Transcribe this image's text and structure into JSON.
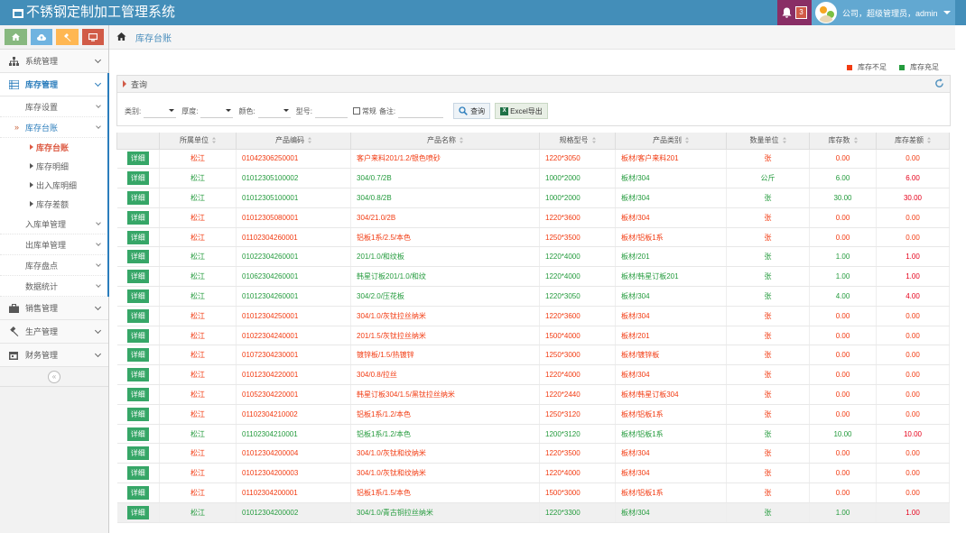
{
  "app": {
    "title": "不锈钢定制加工管理系统"
  },
  "header": {
    "notification_count": "3",
    "user_text": "公司，超级管理员，admin"
  },
  "sidebar": {
    "menu": [
      {
        "label": "系统管理"
      },
      {
        "label": "库存管理"
      },
      {
        "label": "销售管理"
      },
      {
        "label": "生产管理"
      },
      {
        "label": "财务管理"
      }
    ],
    "submenu": [
      {
        "label": "库存设置"
      },
      {
        "label": "库存台账"
      },
      {
        "label": "入库单管理"
      },
      {
        "label": "出库单管理"
      },
      {
        "label": "库存盘点"
      },
      {
        "label": "数据统计"
      }
    ],
    "subsub": [
      {
        "label": "库存台账"
      },
      {
        "label": "库存明细"
      },
      {
        "label": "出入库明细"
      },
      {
        "label": "库存差额"
      }
    ]
  },
  "breadcrumb": {
    "current": "库存台账"
  },
  "legend": {
    "low": "库存不足",
    "ok": "库存充足"
  },
  "colors": {
    "low": "#f23b12",
    "ok": "#249b3d",
    "brand": "#438eb9"
  },
  "query": {
    "title": "查询",
    "category_label": "类别:",
    "thickness_label": "厚度:",
    "color_label": "颜色:",
    "model_label": "型号:",
    "regular_label": "常规",
    "remark_label": "备注:",
    "search_btn": "查询",
    "excel_btn": "Excel导出"
  },
  "table": {
    "headers": [
      "",
      "所属单位",
      "产品编码",
      "产品名称",
      "规格型号",
      "产品类别",
      "数量单位",
      "库存数",
      "库存差额"
    ],
    "action_label": "详细",
    "rows": [
      {
        "status": "red",
        "unit": "松江",
        "code": "01042306250001",
        "name": "客户来料201/1.2/银色喷砂",
        "spec": "1220*3050",
        "cat": "板材/客户来料201",
        "qty_unit": "张",
        "stock": "0.00",
        "diff": "0.00"
      },
      {
        "status": "green",
        "unit": "松江",
        "code": "01012305100002",
        "name": "304/0.7/2B",
        "spec": "1000*2000",
        "cat": "板材/304",
        "qty_unit": "公斤",
        "stock": "6.00",
        "diff": "6.00"
      },
      {
        "status": "green",
        "unit": "松江",
        "code": "01012305100001",
        "name": "304/0.8/2B",
        "spec": "1000*2000",
        "cat": "板材/304",
        "qty_unit": "张",
        "stock": "30.00",
        "diff": "30.00"
      },
      {
        "status": "red",
        "unit": "松江",
        "code": "01012305080001",
        "name": "304/21.0/2B",
        "spec": "1220*3600",
        "cat": "板材/304",
        "qty_unit": "张",
        "stock": "0.00",
        "diff": "0.00"
      },
      {
        "status": "red",
        "unit": "松江",
        "code": "01102304260001",
        "name": "铝板1系/2.5/本色",
        "spec": "1250*3500",
        "cat": "板材/铝板1系",
        "qty_unit": "张",
        "stock": "0.00",
        "diff": "0.00"
      },
      {
        "status": "green",
        "unit": "松江",
        "code": "01022304260001",
        "name": "201/1.0/和纹板",
        "spec": "1220*4000",
        "cat": "板材/201",
        "qty_unit": "张",
        "stock": "1.00",
        "diff": "1.00"
      },
      {
        "status": "green",
        "unit": "松江",
        "code": "01062304260001",
        "name": "韩星订板201/1.0/和纹",
        "spec": "1220*4000",
        "cat": "板材/韩星订板201",
        "qty_unit": "张",
        "stock": "1.00",
        "diff": "1.00"
      },
      {
        "status": "green",
        "unit": "松江",
        "code": "01012304260001",
        "name": "304/2.0/压花板",
        "spec": "1220*3050",
        "cat": "板材/304",
        "qty_unit": "张",
        "stock": "4.00",
        "diff": "4.00"
      },
      {
        "status": "red",
        "unit": "松江",
        "code": "01012304250001",
        "name": "304/1.0/灰钛拉丝纳米",
        "spec": "1220*3600",
        "cat": "板材/304",
        "qty_unit": "张",
        "stock": "0.00",
        "diff": "0.00"
      },
      {
        "status": "red",
        "unit": "松江",
        "code": "01022304240001",
        "name": "201/1.5/灰钛拉丝纳米",
        "spec": "1500*4000",
        "cat": "板材/201",
        "qty_unit": "张",
        "stock": "0.00",
        "diff": "0.00"
      },
      {
        "status": "red",
        "unit": "松江",
        "code": "01072304230001",
        "name": "镀锌板/1.5/热镀锌",
        "spec": "1250*3000",
        "cat": "板材/镀锌板",
        "qty_unit": "张",
        "stock": "0.00",
        "diff": "0.00"
      },
      {
        "status": "red",
        "unit": "松江",
        "code": "01012304220001",
        "name": "304/0.8/拉丝",
        "spec": "1220*4000",
        "cat": "板材/304",
        "qty_unit": "张",
        "stock": "0.00",
        "diff": "0.00"
      },
      {
        "status": "red",
        "unit": "松江",
        "code": "01052304220001",
        "name": "韩星订板304/1.5/黑钛拉丝纳米",
        "spec": "1220*2440",
        "cat": "板材/韩星订板304",
        "qty_unit": "张",
        "stock": "0.00",
        "diff": "0.00"
      },
      {
        "status": "red",
        "unit": "松江",
        "code": "01102304210002",
        "name": "铝板1系/1.2/本色",
        "spec": "1250*3120",
        "cat": "板材/铝板1系",
        "qty_unit": "张",
        "stock": "0.00",
        "diff": "0.00"
      },
      {
        "status": "green",
        "unit": "松江",
        "code": "01102304210001",
        "name": "铝板1系/1.2/本色",
        "spec": "1200*3120",
        "cat": "板材/铝板1系",
        "qty_unit": "张",
        "stock": "10.00",
        "diff": "10.00"
      },
      {
        "status": "red",
        "unit": "松江",
        "code": "01012304200004",
        "name": "304/1.0/灰钛和纹纳米",
        "spec": "1220*3500",
        "cat": "板材/304",
        "qty_unit": "张",
        "stock": "0.00",
        "diff": "0.00"
      },
      {
        "status": "red",
        "unit": "松江",
        "code": "01012304200003",
        "name": "304/1.0/灰钛和纹纳米",
        "spec": "1220*4000",
        "cat": "板材/304",
        "qty_unit": "张",
        "stock": "0.00",
        "diff": "0.00"
      },
      {
        "status": "red",
        "unit": "松江",
        "code": "01102304200001",
        "name": "铝板1系/1.5/本色",
        "spec": "1500*3000",
        "cat": "板材/铝板1系",
        "qty_unit": "张",
        "stock": "0.00",
        "diff": "0.00"
      },
      {
        "status": "green",
        "hl": true,
        "unit": "松江",
        "code": "01012304200002",
        "name": "304/1.0/青古铜拉丝纳米",
        "spec": "1220*3300",
        "cat": "板材/304",
        "qty_unit": "张",
        "stock": "1.00",
        "diff": "1.00"
      }
    ]
  }
}
